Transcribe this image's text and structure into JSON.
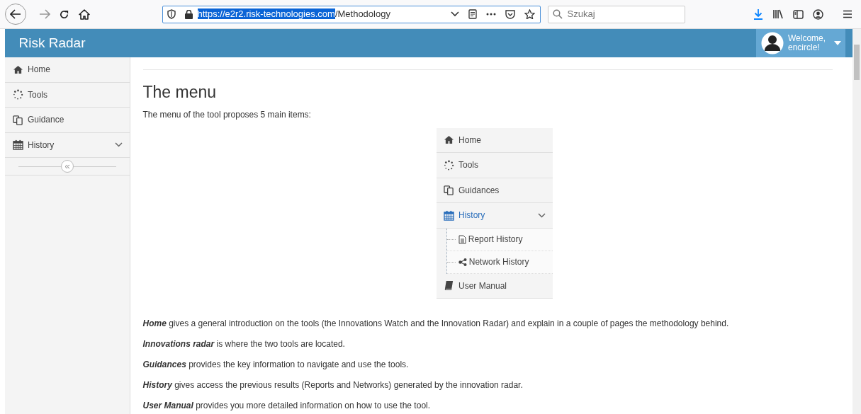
{
  "browser": {
    "url": {
      "highlighted": "https://e2r2.risk-technologies.com",
      "rest": "/Methodology"
    },
    "search": {
      "placeholder": "Szukaj"
    }
  },
  "header": {
    "title": "Risk Radar",
    "user": [
      "Welcome,",
      "encircle!"
    ]
  },
  "sidebar": {
    "items": [
      {
        "label": "Home",
        "kind": "link"
      },
      {
        "label": "Tools",
        "kind": "link"
      },
      {
        "label": "Guidance",
        "kind": "link"
      },
      {
        "label": "History",
        "kind": "group"
      }
    ]
  },
  "content": {
    "title": "The menu",
    "intro": "The menu of the tool proposes 5 main items:",
    "menu_image": {
      "items": [
        {
          "label": "Home",
          "kind": "link",
          "selected": false
        },
        {
          "label": "Tools",
          "kind": "link",
          "selected": false
        },
        {
          "label": "Guidances",
          "kind": "link",
          "selected": false
        },
        {
          "label": "History",
          "kind": "group",
          "selected": true,
          "children": [
            {
              "label": "Report History"
            },
            {
              "label": "Network History"
            }
          ]
        },
        {
          "label": "User Manual",
          "kind": "link",
          "selected": false
        }
      ]
    },
    "paragraphs": [
      "**Home** gives a general introduction on the tools (the Innovations Watch and the Innovation Radar) and explain in a couple of pages the methodology behind.",
      "**Innovations radar** is where the two tools are located.",
      "**Guidances** provides the key information to navigate and use the tools.",
      "**History** gives access the previous results (Reports and Networks) generated by the innovation radar.",
      "**User Manual** provides you more detailed information on how to use the tool."
    ]
  }
}
